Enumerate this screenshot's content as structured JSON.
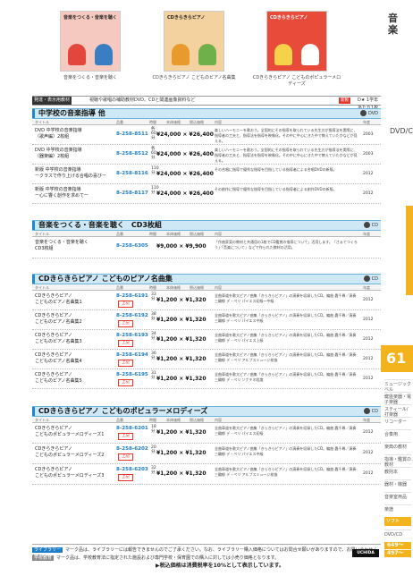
{
  "sidebar": {
    "category": "音楽",
    "subcategory": "DVD/CD",
    "page_number": "61",
    "items": [
      "ミュージックベル",
      "鍵盤楽器・電子楽器",
      "スティール/打楽器",
      "リコーダー",
      "合奏用",
      "楽典の教材",
      "指導・鑑賞の教材",
      "教則本",
      "器材・機器",
      "音楽室用品",
      "楽譜",
      "ソフト",
      "DVD/CD"
    ],
    "active_item": "ソフト",
    "codes": [
      "649〜",
      "497〜"
    ]
  },
  "covers": [
    {
      "title": "音楽をつくる・音楽を聴く",
      "caption": "音楽をつくる・音楽を聴く",
      "bg": "#f6c9c0"
    },
    {
      "title": "CDきらきらピアノ",
      "caption": "CDきらきらピアノ こどものピアノ名曲集",
      "bg": "#f4d2a0"
    },
    {
      "title": "CDきらきらピアノ",
      "caption": "CDきらきらピアノ こどものポピュラーメロディーズ",
      "bg": "#e84b3a"
    }
  ],
  "legend": {
    "tag": "発達・表示用教材",
    "text": "視聴や歌唱の補助教材DVD、CDと関連画像資料など",
    "new": "新製",
    "right": "D★ 1学年あたり1枚数"
  },
  "sections": [
    {
      "title": "中学校の音楽指導",
      "suffix": "他",
      "mark": "DVD",
      "col_head": [
        "タイトル",
        "品番",
        "時間",
        "本体価格",
        "税込価格",
        "内容",
        "年度"
      ],
      "rows": [
        {
          "name": [
            "DVD 中学校の音楽指導",
            "（歌声編）2枚組"
          ],
          "code": "8-258-8511",
          "minutes": "各60分",
          "price": "¥24,000",
          "tax_price": "¥26,400",
          "desc": "楽しいハーモニーを歌おう。全国的にその指導を取られている先生方が指導法を実際に、指導者の工夫と、指導法を指導を映像化。その中に中心にきた中で教えていたかなどが見える。",
          "year": "2003"
        },
        {
          "name": [
            "DVD 中学校の音楽指導",
            "（器楽編）2枚組"
          ],
          "code": "8-258-8512",
          "minutes": "各60分",
          "price": "¥24,000",
          "tax_price": "¥26,400",
          "desc": "楽しいハーモニーを歌おう。全国的にその指導を取られている先生方が指導法を実際に、指導者の工夫と、指導法を指導を映像化。その中に中心にきた中で教えていたかなどが見える。",
          "year": "2003"
        },
        {
          "name": [
            "新版 中学校の音楽指導",
            "ークラスで作り上げる合唱の喜びー"
          ],
          "code": "8-258-8116",
          "minutes": "110分",
          "price": "¥24,000",
          "tax_price": "¥26,400",
          "desc": "その合唱に指導で優秀な指導を目指している指導者による合唱DVDの新版。",
          "year": "2012"
        },
        {
          "name": [
            "新版 中学校の音楽指導",
            "ー心に響く創作を求めてー"
          ],
          "code": "8-258-8117",
          "minutes": "110分",
          "price": "¥24,000",
          "tax_price": "¥26,400",
          "desc": "その創作に指導で優秀な指導を目指している指導者による創作DVDの新版。",
          "year": "2012"
        }
      ]
    },
    {
      "title": "音楽をつくる・音楽を聴く　CD3枚組",
      "suffix": "",
      "mark": "CD",
      "col_head": [
        "タイトル",
        "品番",
        "時間",
        "本体価格",
        "税込価格",
        "内容",
        "年度"
      ],
      "rows": [
        {
          "name": [
            "音楽をつくる・音楽を聴く",
            "CD3枚組"
          ],
          "code": "8-258-6305",
          "minutes": "",
          "price": "¥9,000",
          "tax_price": "¥9,900",
          "desc": "「作曲家案の教材と共通用の1枚でCD鑑賞の指導について」活用します。「さぁてつくろう」「音楽について」などで作られた教材の活用。",
          "year": ""
        }
      ]
    },
    {
      "title": "CDきらきらピアノ こどものピアノ名曲集",
      "suffix": "",
      "mark": "CD",
      "col_head": [
        "タイトル",
        "品番",
        "時間",
        "本体価格",
        "税込価格",
        "内容",
        "年度"
      ],
      "rows": [
        {
          "name": [
            "CDきらきらピアノ",
            "こどものピアノ名曲集1"
          ],
          "code": "8-258-6191",
          "new": "上記",
          "minutes": "33分",
          "price": "¥1,200",
          "tax_price": "¥1,320",
          "desc": "全曲車道を歌大ピアノ曲集「きらきらピアノ」の演奏を収録したCD。編曲 轟千尋／演奏 三輪郁 デ・ペリ パイエス初級〜中級",
          "year": "2012"
        },
        {
          "name": [
            "CDきらきらピアノ",
            "こどものピアノ名曲集2"
          ],
          "code": "8-258-6192",
          "new": "上記",
          "minutes": "38分",
          "price": "¥1,200",
          "tax_price": "¥1,320",
          "desc": "全曲車道を歌大ピアノ曲集「きらきらピアノ」の演奏を収録したCD。編曲 轟千尋／演奏 三輪郁 デ・ペリ パイエス中級",
          "year": "2012"
        },
        {
          "name": [
            "CDきらきらピアノ",
            "こどものピアノ名曲集3"
          ],
          "code": "8-258-6193",
          "new": "上記",
          "minutes": "34分",
          "price": "¥1,200",
          "tax_price": "¥1,320",
          "desc": "全曲車道を歌大ピアノ曲集「きらきらピアノ」の演奏を収録したCD。編曲 轟千尋／演奏 三輪郁 デ・ペリ パイエス上級",
          "year": "2012"
        },
        {
          "name": [
            "CDきらきらピアノ",
            "こどものピアノ名曲集4"
          ],
          "code": "8-258-6194",
          "new": "上記",
          "minutes": "36分",
          "price": "¥1,200",
          "tax_price": "¥1,320",
          "desc": "全曲車道を歌大ピアノ曲集「きらきらピアノ」の演奏を収録したCD。編曲 轟千尋／演奏 三輪郁 デ・ペリ アルプスミュージ校協",
          "year": "2012"
        },
        {
          "name": [
            "CDきらきらピアノ",
            "こどものピアノ名曲集5"
          ],
          "code": "8-258-6195",
          "new": "上記",
          "minutes": "31分",
          "price": "¥1,200",
          "tax_price": "¥1,320",
          "desc": "全曲車道を歌大ピアノ曲集「きらきらピアノ」の演奏を収録したCD。編曲 轟千尋／演奏 三輪郁 デ・ペリ ソナチネ程度",
          "year": "2012"
        }
      ]
    },
    {
      "title": "CDきらきらピアノ こどものポピュラーメロディーズ",
      "suffix": "",
      "mark": "CD",
      "col_head": [
        "タイトル",
        "品番",
        "時間",
        "本体価格",
        "税込価格",
        "内容",
        "年度"
      ],
      "rows": [
        {
          "name": [
            "CDきらきらピアノ",
            "こどものポピュラーメロディーズ1"
          ],
          "code": "8-258-6201",
          "new": "上記",
          "minutes": "18分",
          "price": "¥1,200",
          "tax_price": "¥1,320",
          "desc": "全曲車道を歌大ピアノ曲集「きらきらピアノ」の演奏を収録したCD。編曲 轟千尋／演奏 三輪郁 デ・ペリ パイエス初級",
          "year": "2012"
        },
        {
          "name": [
            "CDきらきらピアノ",
            "こどものポピュラーメロディーズ2"
          ],
          "code": "8-258-6202",
          "new": "上記",
          "minutes": "20分",
          "price": "¥1,200",
          "tax_price": "¥1,320",
          "desc": "全曲車道を歌大ピアノ曲集「きらきらピアノ」の演奏を収録したCD。編曲 轟千尋／演奏 三輪郁 デ・ペリ パイエス中級",
          "year": "2012"
        },
        {
          "name": [
            "CDきらきらピアノ",
            "こどものポピュラーメロディーズ3"
          ],
          "code": "8-258-6203",
          "new": "上記",
          "minutes": "32分",
          "price": "¥1,200",
          "tax_price": "¥1,320",
          "desc": "全曲車道を歌大ピアノ曲集「きらきらピアノ」の演奏を収録したCD。編曲 轟千尋／演奏 三輪郁 デ・ペリ アルプスミュージ校協",
          "year": "2012"
        }
      ]
    }
  ],
  "footer": {
    "line1_badge": "ライブラリー",
    "line1": "マーク品は、ライブラリーには報告できませんのでご了承ください。なお、ライブラリー購入価格についてはお問合せ願いがありますので、お問い合わせください。",
    "line2_badge": "学校教育",
    "line2": "マーク品は、学校教育法に指定された施設および専門学校・保育園での購入に対しては小売り価格となります。",
    "tax_note": "▶税込価格は消費税率を10%として表示しています。",
    "logo": "UCHIDA"
  }
}
